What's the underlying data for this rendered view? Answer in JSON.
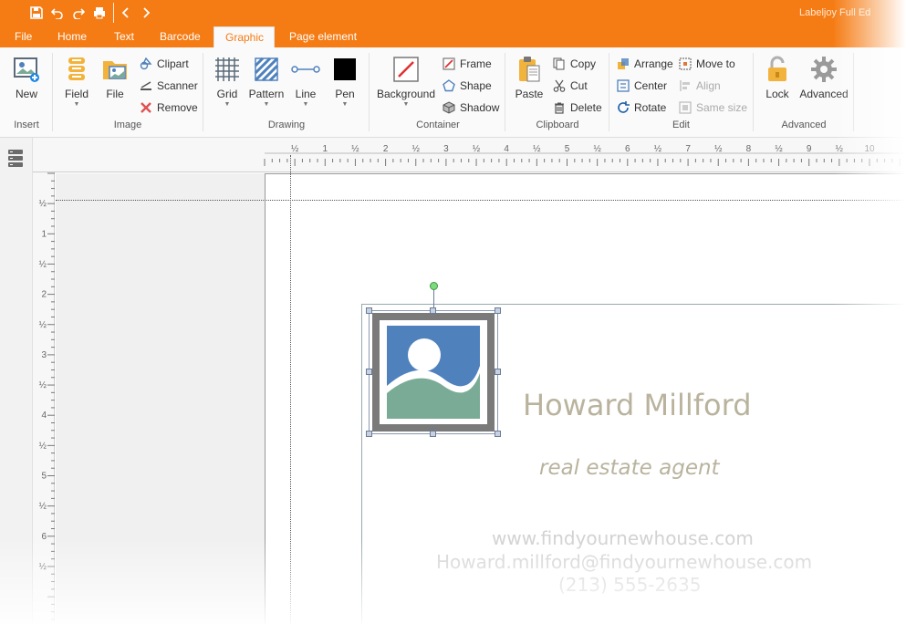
{
  "app": {
    "title": "Labeljoy Full Ed"
  },
  "menu": {
    "tabs": [
      "File",
      "Home",
      "Text",
      "Barcode",
      "Graphic",
      "Page element"
    ],
    "active": "Graphic"
  },
  "ribbon": {
    "insert": {
      "label": "Insert",
      "new": "New"
    },
    "image": {
      "label": "Image",
      "field": "Field",
      "file": "File",
      "clipart": "Clipart",
      "scanner": "Scanner",
      "remove": "Remove"
    },
    "drawing": {
      "label": "Drawing",
      "grid": "Grid",
      "pattern": "Pattern",
      "line": "Line",
      "pen": "Pen"
    },
    "container": {
      "label": "Container",
      "background": "Background",
      "frame": "Frame",
      "shape": "Shape",
      "shadow": "Shadow"
    },
    "clipboard": {
      "label": "Clipboard",
      "paste": "Paste",
      "copy": "Copy",
      "cut": "Cut",
      "delete": "Delete"
    },
    "edit": {
      "label": "Edit",
      "arrange": "Arrange",
      "center": "Center",
      "rotate": "Rotate",
      "move_to": "Move to",
      "align": "Align",
      "same_size": "Same size"
    },
    "advanced": {
      "label": "Advanced",
      "lock": "Lock",
      "advanced": "Advanced"
    }
  },
  "rulers": {
    "h_labels": [
      "½",
      "1",
      "½",
      "2",
      "½",
      "3",
      "½",
      "4",
      "½",
      "5",
      "½",
      "6",
      "½",
      "7",
      "½",
      "8",
      "½",
      "9",
      "½",
      "10"
    ],
    "v_labels": [
      "½",
      "1",
      "½",
      "2",
      "½",
      "3",
      "½",
      "4",
      "½",
      "5",
      "½",
      "6",
      "½"
    ]
  },
  "label": {
    "name": "Howard Millford",
    "role": "real estate agent",
    "website": "www.findyournewhouse.com",
    "email": "Howard.millford@findyournewhouse.com",
    "phone": "(213) 555-2635"
  },
  "colors": {
    "brand": "#f57c14",
    "name_text": "#b9b39e",
    "contact_text": "#d2d2d2",
    "image_blue": "#4f81bd",
    "image_green": "#7aab96",
    "image_frame": "#7a7a7a"
  }
}
